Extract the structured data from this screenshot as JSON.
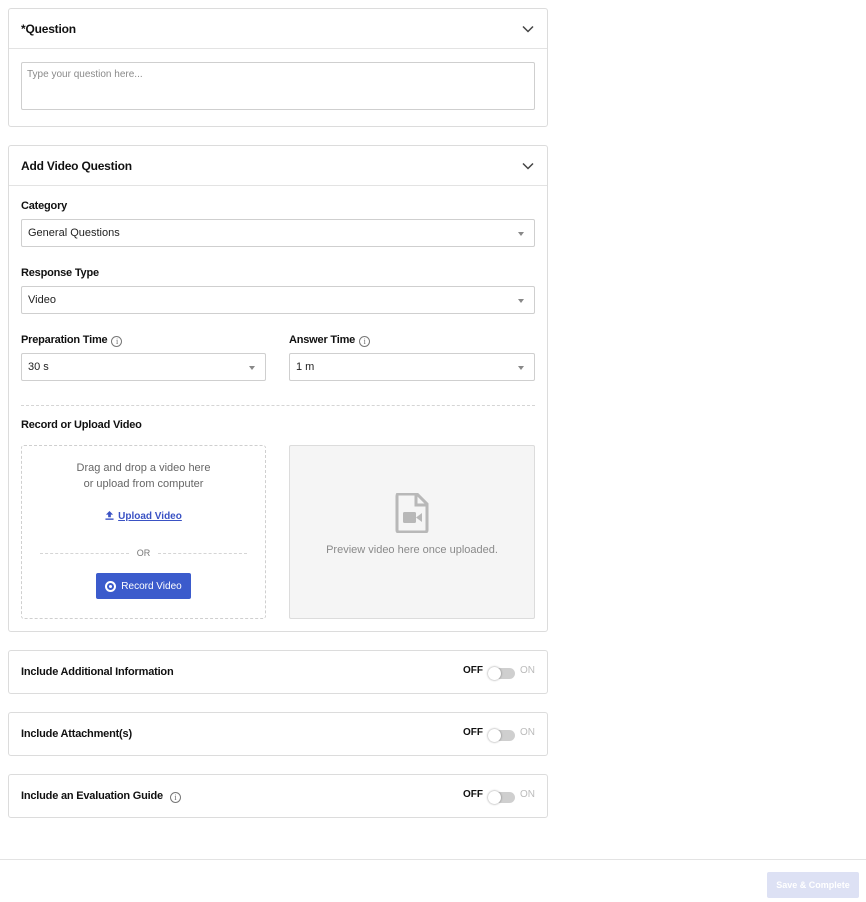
{
  "question_card": {
    "title": "*Question",
    "placeholder": "Type your question here..."
  },
  "video_card": {
    "title": "Add Video Question",
    "category": {
      "label": "Category",
      "value": "General Questions"
    },
    "response_type": {
      "label": "Response Type",
      "value": "Video"
    },
    "preparation_time": {
      "label": "Preparation Time",
      "value": "30 s"
    },
    "answer_time": {
      "label": "Answer Time",
      "value": "1 m"
    },
    "record_upload": {
      "label": "Record or Upload Video",
      "drop_line1": "Drag and drop a video here",
      "drop_line2": "or upload from computer",
      "upload_label": "Upload Video",
      "or_label": "OR",
      "record_label": "Record Video",
      "preview_text": "Preview video here once uploaded."
    }
  },
  "toggles": [
    {
      "title": "Include Additional Information",
      "off": "OFF",
      "on": "ON"
    },
    {
      "title": "Include Attachment(s)",
      "off": "OFF",
      "on": "ON"
    },
    {
      "title": "Include an Evaluation Guide",
      "off": "OFF",
      "on": "ON"
    }
  ],
  "footer": {
    "save_label": "Save & Complete"
  },
  "colors": {
    "accent": "#3b5bcc",
    "disabled_button": "#dde1f4"
  },
  "icons": {
    "info": "i"
  }
}
